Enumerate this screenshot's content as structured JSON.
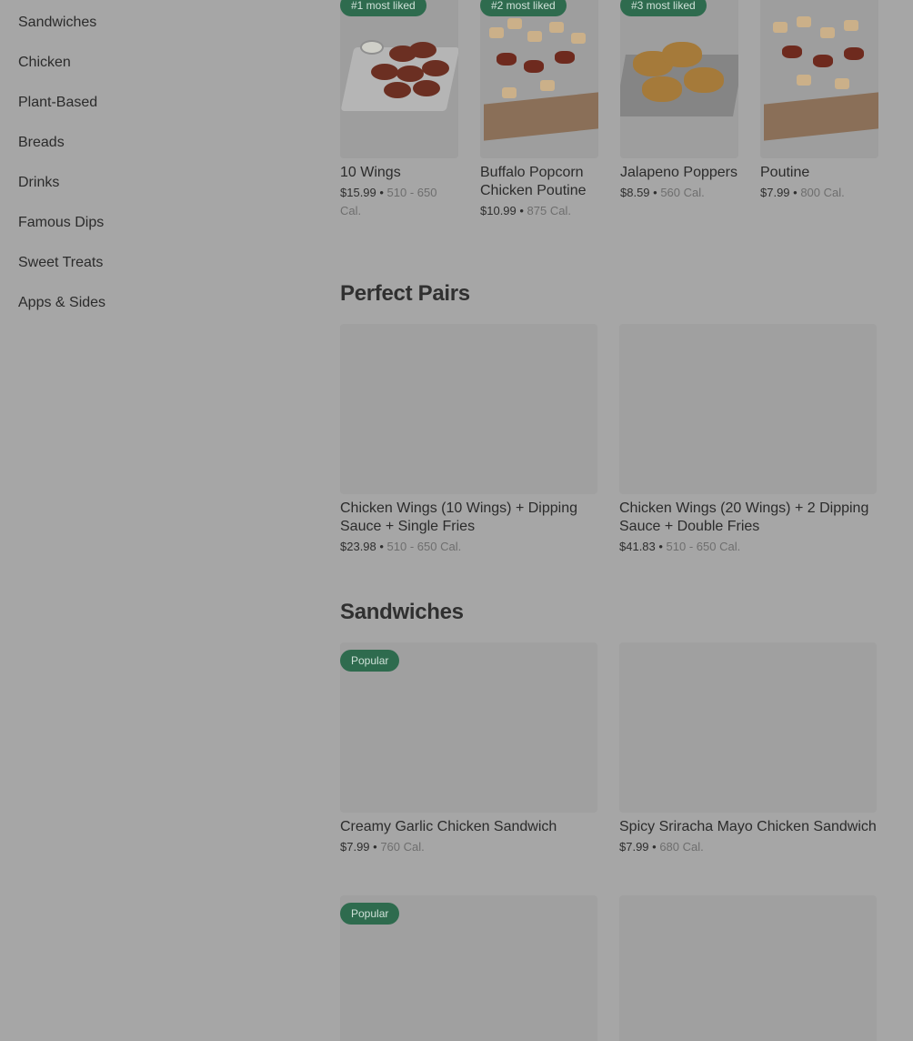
{
  "sidebar": {
    "items": [
      {
        "label": "Sandwiches"
      },
      {
        "label": "Chicken"
      },
      {
        "label": "Plant-Based"
      },
      {
        "label": "Breads"
      },
      {
        "label": "Drinks"
      },
      {
        "label": "Famous Dips"
      },
      {
        "label": "Sweet Treats"
      },
      {
        "label": "Apps & Sides"
      }
    ]
  },
  "most_liked": [
    {
      "badge": "#1 most liked",
      "name": "10 Wings",
      "price": "$15.99",
      "sep": " • ",
      "cal": "510 - 650 Cal.",
      "image": "wings-photo"
    },
    {
      "badge": "#2 most liked",
      "name": "Buffalo Popcorn Chicken Poutine",
      "price": "$10.99",
      "sep": " • ",
      "cal": "875 Cal.",
      "image": "poutine-photo"
    },
    {
      "badge": "#3 most liked",
      "name": "Jalapeno Poppers",
      "price": "$8.59",
      "sep": " • ",
      "cal": "560 Cal.",
      "image": "poppers-photo"
    },
    {
      "badge": "",
      "name": "Poutine",
      "price": "$7.99",
      "sep": " • ",
      "cal": "800 Cal.",
      "image": "poutine-photo"
    }
  ],
  "perfect_pairs": {
    "title": "Perfect Pairs",
    "items": [
      {
        "name": "Chicken Wings (10 Wings) + Dipping Sauce + Single Fries",
        "price": "$23.98",
        "sep": " • ",
        "cal": "510 - 650 Cal."
      },
      {
        "name": "Chicken Wings (20 Wings) + 2 Dipping Sauce + Double Fries",
        "price": "$41.83",
        "sep": " • ",
        "cal": "510 - 650 Cal."
      }
    ]
  },
  "sandwiches": {
    "title": "Sandwiches",
    "items": [
      {
        "badge": "Popular",
        "name": "Creamy Garlic Chicken Sandwich",
        "price": "$7.99",
        "sep": " • ",
        "cal": "760 Cal."
      },
      {
        "badge": "",
        "name": "Spicy Sriracha Mayo Chicken Sandwich",
        "price": "$7.99",
        "sep": " • ",
        "cal": "680 Cal."
      },
      {
        "badge": "Popular",
        "name": "",
        "price": "",
        "sep": "",
        "cal": ""
      },
      {
        "badge": "",
        "name": "",
        "price": "",
        "sep": "",
        "cal": ""
      }
    ]
  },
  "colors": {
    "overlay_background": "#a6a6a6",
    "badge_green": "#2e6b4e"
  }
}
